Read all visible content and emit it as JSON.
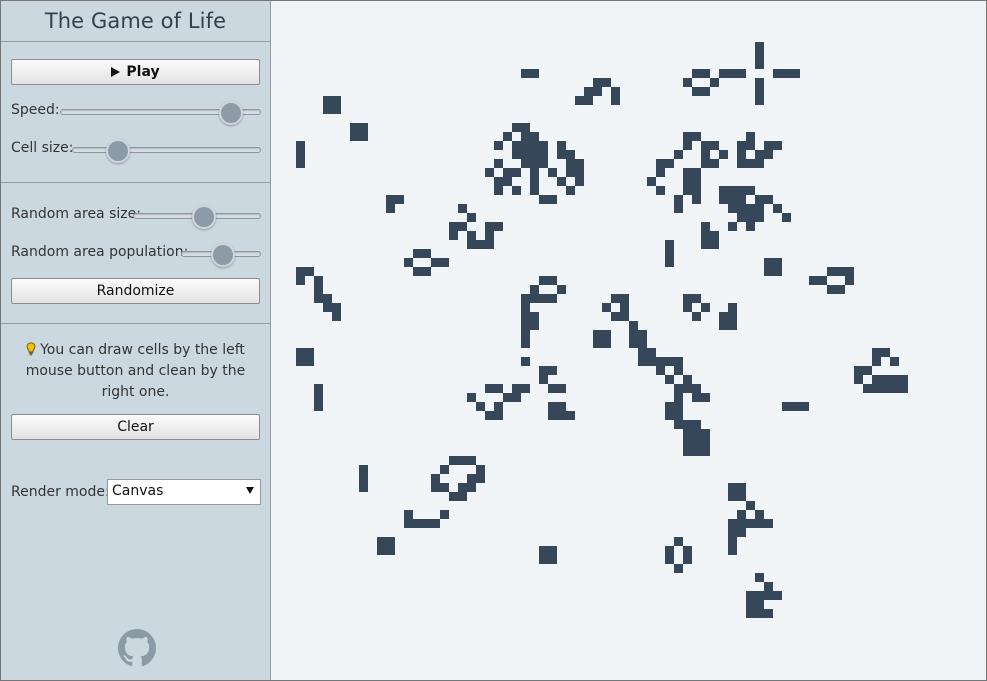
{
  "app": {
    "title": "The Game of Life"
  },
  "controls": {
    "play_label": "Play",
    "speed_label": "Speed:",
    "speed_value": 0.88,
    "cell_size_label": "Cell size:",
    "cell_size_value": 0.2,
    "random_area_size_label": "Random area size:",
    "random_area_size_value": 0.55,
    "random_area_population_label": "Random area population:",
    "random_area_population_value": 0.5,
    "randomize_label": "Randomize",
    "hint_text": "You can draw cells by the left mouse button and clean by the right one.",
    "clear_label": "Clear",
    "render_mode_label": "Render mode:",
    "render_mode_value": "Canvas"
  },
  "icons": {
    "hint": "lightbulb-icon",
    "play": "play-icon",
    "github": "github-icon",
    "dropdown": "chevron-down-icon"
  },
  "colors": {
    "sidebar_bg": "#ccd8e0",
    "board_bg": "#f1f5f8",
    "cell": "#36475a",
    "bulb": "#e8b400"
  },
  "board": {
    "cells": [
      [
        52,
        2
      ],
      [
        52,
        3
      ],
      [
        52,
        4
      ],
      [
        48,
        5
      ],
      [
        49,
        5
      ],
      [
        50,
        5
      ],
      [
        54,
        5
      ],
      [
        55,
        5
      ],
      [
        56,
        5
      ],
      [
        52,
        6
      ],
      [
        52,
        7
      ],
      [
        52,
        8
      ],
      [
        26,
        5
      ],
      [
        27,
        5
      ],
      [
        45,
        5
      ],
      [
        46,
        5
      ],
      [
        44,
        6
      ],
      [
        47,
        6
      ],
      [
        45,
        7
      ],
      [
        46,
        7
      ],
      [
        34,
        6
      ],
      [
        35,
        6
      ],
      [
        33,
        7
      ],
      [
        34,
        7
      ],
      [
        36,
        7
      ],
      [
        32,
        8
      ],
      [
        33,
        8
      ],
      [
        36,
        8
      ],
      [
        4,
        8
      ],
      [
        5,
        8
      ],
      [
        4,
        9
      ],
      [
        5,
        9
      ],
      [
        7,
        11
      ],
      [
        8,
        11
      ],
      [
        7,
        12
      ],
      [
        8,
        12
      ],
      [
        1,
        13
      ],
      [
        1,
        14
      ],
      [
        1,
        15
      ],
      [
        25,
        11
      ],
      [
        26,
        11
      ],
      [
        24,
        12
      ],
      [
        26,
        12
      ],
      [
        27,
        12
      ],
      [
        23,
        13
      ],
      [
        25,
        13
      ],
      [
        26,
        13
      ],
      [
        27,
        13
      ],
      [
        28,
        13
      ],
      [
        30,
        13
      ],
      [
        25,
        14
      ],
      [
        26,
        14
      ],
      [
        27,
        14
      ],
      [
        28,
        14
      ],
      [
        30,
        14
      ],
      [
        31,
        14
      ],
      [
        23,
        15
      ],
      [
        26,
        15
      ],
      [
        27,
        15
      ],
      [
        28,
        15
      ],
      [
        31,
        15
      ],
      [
        32,
        15
      ],
      [
        22,
        16
      ],
      [
        24,
        16
      ],
      [
        25,
        16
      ],
      [
        27,
        16
      ],
      [
        29,
        16
      ],
      [
        31,
        16
      ],
      [
        32,
        16
      ],
      [
        23,
        17
      ],
      [
        24,
        17
      ],
      [
        27,
        17
      ],
      [
        30,
        17
      ],
      [
        32,
        17
      ],
      [
        23,
        18
      ],
      [
        25,
        18
      ],
      [
        27,
        18
      ],
      [
        31,
        18
      ],
      [
        28,
        19
      ],
      [
        29,
        19
      ],
      [
        44,
        12
      ],
      [
        45,
        12
      ],
      [
        44,
        13
      ],
      [
        46,
        13
      ],
      [
        47,
        13
      ],
      [
        43,
        14
      ],
      [
        46,
        14
      ],
      [
        48,
        14
      ],
      [
        46,
        15
      ],
      [
        47,
        15
      ],
      [
        41,
        15
      ],
      [
        42,
        15
      ],
      [
        41,
        16
      ],
      [
        44,
        16
      ],
      [
        45,
        16
      ],
      [
        40,
        17
      ],
      [
        44,
        17
      ],
      [
        45,
        17
      ],
      [
        41,
        18
      ],
      [
        44,
        18
      ],
      [
        45,
        18
      ],
      [
        43,
        19
      ],
      [
        45,
        19
      ],
      [
        43,
        20
      ],
      [
        51,
        12
      ],
      [
        50,
        13
      ],
      [
        51,
        13
      ],
      [
        53,
        13
      ],
      [
        54,
        13
      ],
      [
        50,
        14
      ],
      [
        52,
        14
      ],
      [
        53,
        14
      ],
      [
        50,
        15
      ],
      [
        51,
        15
      ],
      [
        52,
        15
      ],
      [
        48,
        18
      ],
      [
        49,
        18
      ],
      [
        50,
        18
      ],
      [
        51,
        18
      ],
      [
        48,
        19
      ],
      [
        49,
        19
      ],
      [
        50,
        19
      ],
      [
        52,
        19
      ],
      [
        53,
        19
      ],
      [
        49,
        20
      ],
      [
        50,
        20
      ],
      [
        51,
        20
      ],
      [
        52,
        20
      ],
      [
        54,
        20
      ],
      [
        50,
        21
      ],
      [
        51,
        21
      ],
      [
        52,
        21
      ],
      [
        55,
        21
      ],
      [
        49,
        22
      ],
      [
        51,
        22
      ],
      [
        46,
        22
      ],
      [
        46,
        23
      ],
      [
        46,
        24
      ],
      [
        47,
        23
      ],
      [
        47,
        24
      ],
      [
        11,
        19
      ],
      [
        12,
        19
      ],
      [
        11,
        20
      ],
      [
        19,
        20
      ],
      [
        20,
        21
      ],
      [
        18,
        22
      ],
      [
        19,
        22
      ],
      [
        18,
        23
      ],
      [
        22,
        22
      ],
      [
        23,
        22
      ],
      [
        20,
        23
      ],
      [
        22,
        23
      ],
      [
        20,
        24
      ],
      [
        21,
        24
      ],
      [
        22,
        24
      ],
      [
        14,
        25
      ],
      [
        15,
        25
      ],
      [
        13,
        26
      ],
      [
        16,
        26
      ],
      [
        17,
        26
      ],
      [
        14,
        27
      ],
      [
        15,
        27
      ],
      [
        42,
        24
      ],
      [
        42,
        25
      ],
      [
        42,
        26
      ],
      [
        53,
        26
      ],
      [
        53,
        27
      ],
      [
        54,
        26
      ],
      [
        54,
        27
      ],
      [
        60,
        27
      ],
      [
        61,
        27
      ],
      [
        62,
        27
      ],
      [
        58,
        28
      ],
      [
        59,
        28
      ],
      [
        62,
        28
      ],
      [
        60,
        29
      ],
      [
        61,
        29
      ],
      [
        1,
        27
      ],
      [
        2,
        27
      ],
      [
        1,
        28
      ],
      [
        3,
        28
      ],
      [
        3,
        29
      ],
      [
        4,
        30
      ],
      [
        3,
        30
      ],
      [
        4,
        31
      ],
      [
        5,
        31
      ],
      [
        5,
        32
      ],
      [
        28,
        28
      ],
      [
        29,
        28
      ],
      [
        27,
        29
      ],
      [
        30,
        29
      ],
      [
        28,
        30
      ],
      [
        29,
        30
      ],
      [
        26,
        30
      ],
      [
        27,
        30
      ],
      [
        26,
        31
      ],
      [
        26,
        32
      ],
      [
        27,
        32
      ],
      [
        27,
        33
      ],
      [
        26,
        33
      ],
      [
        26,
        34
      ],
      [
        26,
        35
      ],
      [
        36,
        30
      ],
      [
        37,
        30
      ],
      [
        35,
        31
      ],
      [
        37,
        31
      ],
      [
        36,
        32
      ],
      [
        37,
        32
      ],
      [
        44,
        30
      ],
      [
        45,
        30
      ],
      [
        44,
        31
      ],
      [
        46,
        31
      ],
      [
        45,
        32
      ],
      [
        49,
        31
      ],
      [
        48,
        32
      ],
      [
        49,
        32
      ],
      [
        49,
        33
      ],
      [
        48,
        33
      ],
      [
        38,
        33
      ],
      [
        38,
        34
      ],
      [
        39,
        34
      ],
      [
        39,
        35
      ],
      [
        38,
        35
      ],
      [
        39,
        36
      ],
      [
        40,
        36
      ],
      [
        39,
        37
      ],
      [
        40,
        37
      ],
      [
        41,
        37
      ],
      [
        34,
        34
      ],
      [
        35,
        34
      ],
      [
        34,
        35
      ],
      [
        35,
        35
      ],
      [
        1,
        36
      ],
      [
        2,
        36
      ],
      [
        1,
        37
      ],
      [
        2,
        37
      ],
      [
        42,
        37
      ],
      [
        43,
        37
      ],
      [
        41,
        38
      ],
      [
        43,
        38
      ],
      [
        42,
        39
      ],
      [
        44,
        39
      ],
      [
        43,
        40
      ],
      [
        44,
        40
      ],
      [
        45,
        40
      ],
      [
        43,
        41
      ],
      [
        45,
        41
      ],
      [
        46,
        41
      ],
      [
        42,
        42
      ],
      [
        43,
        42
      ],
      [
        42,
        43
      ],
      [
        43,
        43
      ],
      [
        43,
        44
      ],
      [
        44,
        44
      ],
      [
        45,
        44
      ],
      [
        44,
        45
      ],
      [
        45,
        45
      ],
      [
        46,
        45
      ],
      [
        44,
        46
      ],
      [
        45,
        46
      ],
      [
        46,
        46
      ],
      [
        46,
        47
      ],
      [
        45,
        47
      ],
      [
        44,
        47
      ],
      [
        26,
        37
      ],
      [
        28,
        38
      ],
      [
        29,
        38
      ],
      [
        28,
        39
      ],
      [
        29,
        40
      ],
      [
        30,
        40
      ],
      [
        25,
        40
      ],
      [
        26,
        40
      ],
      [
        22,
        40
      ],
      [
        23,
        40
      ],
      [
        20,
        41
      ],
      [
        24,
        41
      ],
      [
        25,
        41
      ],
      [
        21,
        42
      ],
      [
        23,
        42
      ],
      [
        22,
        43
      ],
      [
        23,
        43
      ],
      [
        30,
        43
      ],
      [
        31,
        43
      ],
      [
        29,
        43
      ],
      [
        30,
        42
      ],
      [
        29,
        42
      ],
      [
        3,
        40
      ],
      [
        3,
        41
      ],
      [
        3,
        42
      ],
      [
        65,
        36
      ],
      [
        66,
        36
      ],
      [
        65,
        37
      ],
      [
        67,
        37
      ],
      [
        63,
        38
      ],
      [
        64,
        38
      ],
      [
        63,
        39
      ],
      [
        65,
        39
      ],
      [
        66,
        39
      ],
      [
        67,
        39
      ],
      [
        68,
        39
      ],
      [
        64,
        40
      ],
      [
        65,
        40
      ],
      [
        66,
        40
      ],
      [
        67,
        40
      ],
      [
        68,
        40
      ],
      [
        55,
        42
      ],
      [
        56,
        42
      ],
      [
        57,
        42
      ],
      [
        8,
        49
      ],
      [
        8,
        50
      ],
      [
        8,
        51
      ],
      [
        18,
        48
      ],
      [
        19,
        48
      ],
      [
        20,
        48
      ],
      [
        17,
        49
      ],
      [
        21,
        49
      ],
      [
        16,
        50
      ],
      [
        20,
        50
      ],
      [
        21,
        50
      ],
      [
        16,
        51
      ],
      [
        17,
        51
      ],
      [
        19,
        51
      ],
      [
        20,
        51
      ],
      [
        18,
        52
      ],
      [
        19,
        52
      ],
      [
        13,
        54
      ],
      [
        13,
        55
      ],
      [
        14,
        55
      ],
      [
        15,
        55
      ],
      [
        16,
        55
      ],
      [
        17,
        54
      ],
      [
        10,
        57
      ],
      [
        11,
        57
      ],
      [
        10,
        58
      ],
      [
        11,
        58
      ],
      [
        49,
        51
      ],
      [
        50,
        51
      ],
      [
        49,
        52
      ],
      [
        50,
        52
      ],
      [
        51,
        53
      ],
      [
        50,
        54
      ],
      [
        52,
        54
      ],
      [
        49,
        55
      ],
      [
        50,
        55
      ],
      [
        51,
        55
      ],
      [
        52,
        55
      ],
      [
        53,
        55
      ],
      [
        49,
        56
      ],
      [
        50,
        56
      ],
      [
        49,
        57
      ],
      [
        49,
        58
      ],
      [
        28,
        58
      ],
      [
        29,
        58
      ],
      [
        28,
        59
      ],
      [
        29,
        59
      ],
      [
        43,
        57
      ],
      [
        42,
        58
      ],
      [
        44,
        58
      ],
      [
        42,
        59
      ],
      [
        44,
        59
      ],
      [
        43,
        60
      ],
      [
        52,
        61
      ],
      [
        53,
        62
      ],
      [
        51,
        63
      ],
      [
        52,
        63
      ],
      [
        53,
        63
      ],
      [
        54,
        63
      ],
      [
        51,
        64
      ],
      [
        52,
        64
      ],
      [
        53,
        65
      ],
      [
        52,
        65
      ],
      [
        51,
        65
      ]
    ]
  }
}
